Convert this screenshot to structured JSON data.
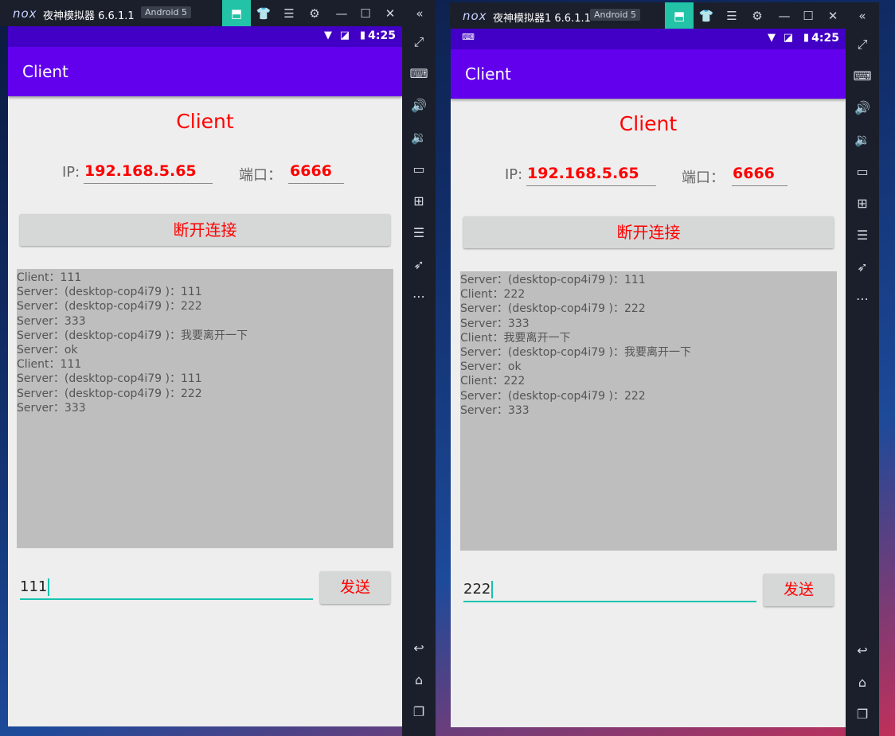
{
  "emulators": [
    {
      "logo": "nox",
      "title": "夜神模拟器 6.6.1.1",
      "android_badge": "Android 5",
      "status_time": "4:25",
      "app_title": "Client",
      "heading": "Client",
      "ip_label": "IP:",
      "ip_value": "192.168.5.65",
      "port_label": "端口：",
      "port_value": "6666",
      "disconnect_label": "断开连接",
      "log_lines": [
        "Client：111",
        "Server：(desktop-cop4i79 )：111",
        "Server：(desktop-cop4i79 )：222",
        "Server：333",
        "Server：(desktop-cop4i79 )：我要离开一下",
        "Server：ok",
        "Client：111",
        "Server：(desktop-cop4i79 )：111",
        "Server：(desktop-cop4i79 )：222",
        "Server：333"
      ],
      "input_value": "111",
      "send_label": "发送"
    },
    {
      "logo": "nox",
      "title": "夜神模拟器1 6.6.1.1",
      "android_badge": "Android 5",
      "status_time": "4:25",
      "app_title": "Client",
      "heading": "Client",
      "ip_label": "IP:",
      "ip_value": "192.168.5.65",
      "port_label": "端口：",
      "port_value": "6666",
      "disconnect_label": "断开连接",
      "log_lines": [
        "Server：(desktop-cop4i79 )：111",
        "Client：222",
        "Server：(desktop-cop4i79 )：222",
        "Server：333",
        "Client：我要离开一下",
        "Server：(desktop-cop4i79 )：我要离开一下",
        "Server：ok",
        "Client：222",
        "Server：(desktop-cop4i79 )：222",
        "Server：333"
      ],
      "input_value": "222",
      "send_label": "发送"
    }
  ],
  "titlebar_icons": [
    "store-icon",
    "shirt-icon",
    "menu-icon",
    "settings-icon",
    "minimize-icon",
    "maximize-icon",
    "close-icon",
    "collapse-icon"
  ],
  "sidebar_icons": [
    "fullscreen-icon",
    "keyboard-icon",
    "volume-up-icon",
    "volume-down-icon",
    "screen-icon",
    "apk-install-icon",
    "multi-instance-icon",
    "rocket-icon",
    "more-icon",
    "back-icon",
    "home-icon",
    "recents-icon"
  ],
  "colors": {
    "titlebar": "#1b1f2b",
    "store_accent": "#22c3a6",
    "statusbar": "#4200c6",
    "appbar": "#6200ee",
    "accent_red": "#ff0000",
    "input_line": "#18c3b0",
    "log_bg": "#bfbebf"
  }
}
